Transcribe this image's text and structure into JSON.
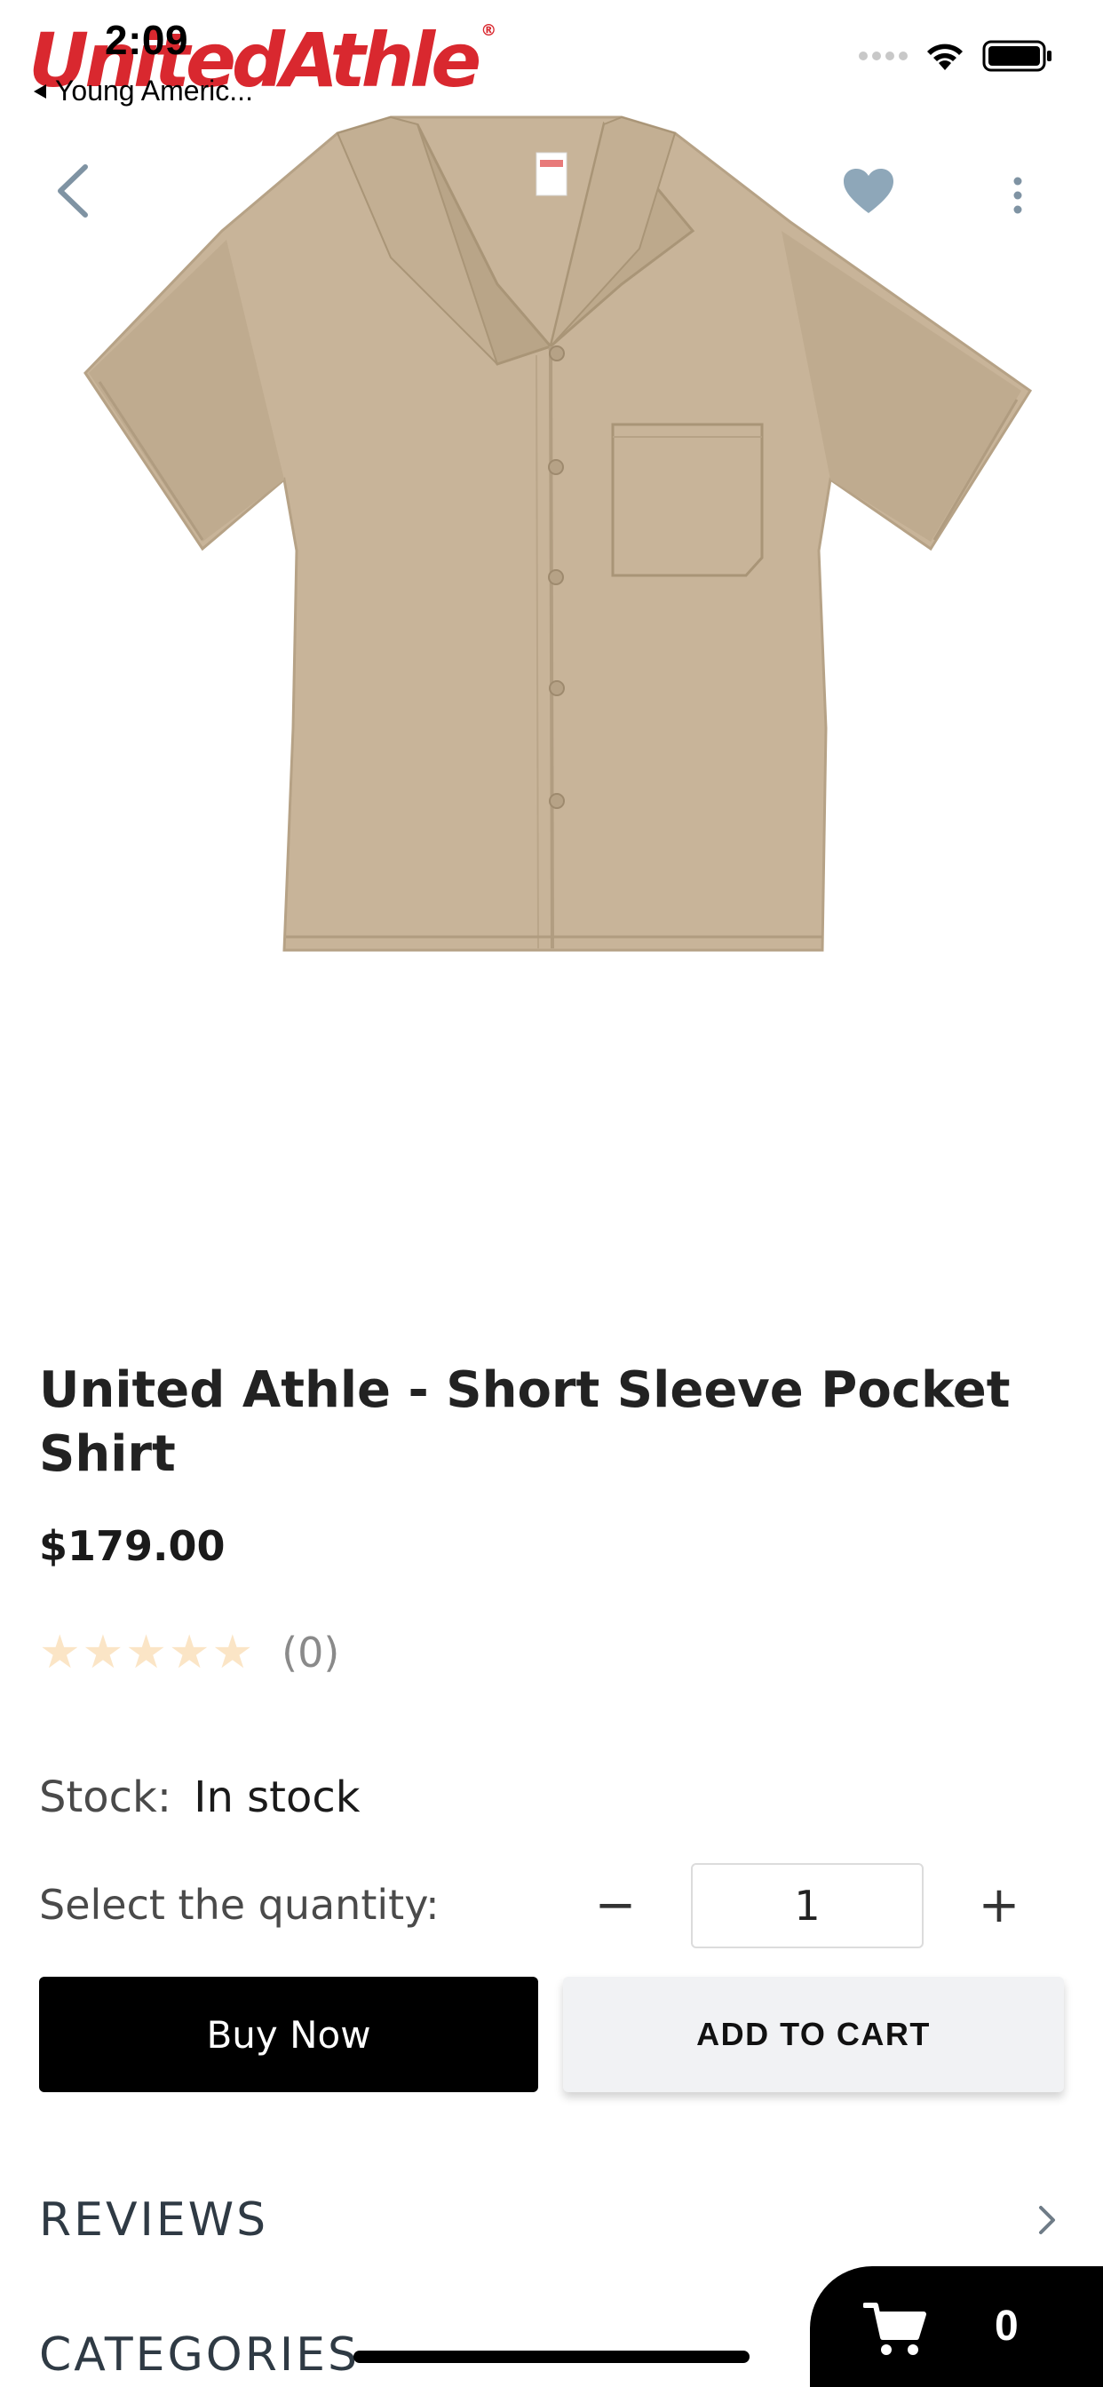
{
  "status_bar": {
    "time": "2:09",
    "back_app": "Young Americ..."
  },
  "brand": {
    "logo_text": "UnitedAthle",
    "registered_mark": "®"
  },
  "header": {
    "back_icon": "chevron-left-icon",
    "favorite_icon": "heart-icon",
    "more_icon": "more-vertical-icon"
  },
  "product": {
    "title": "United Athle - Short Sleeve Pocket Shirt",
    "price": "$179.00",
    "rating": 0,
    "rating_max": 5,
    "review_count": "(0)",
    "stock_label": "Stock:",
    "stock_value": "In stock",
    "quantity_label": "Select the quantity:",
    "quantity_value": "1",
    "quantity_minus": "−",
    "quantity_plus": "+"
  },
  "actions": {
    "buy_now": "Buy Now",
    "add_to_cart": "ADD TO CART"
  },
  "sections": {
    "reviews": "REVIEWS",
    "categories": "CATEGORIES"
  },
  "cart": {
    "count": "0"
  },
  "colors": {
    "brand_red": "#d9282f",
    "shirt_khaki": "#c8b499",
    "favorite_icon": "#8ea7b9",
    "star_empty": "#fbe5c6",
    "buy_button_bg": "#000000",
    "cart_button_bg": "#f1f2f4"
  }
}
